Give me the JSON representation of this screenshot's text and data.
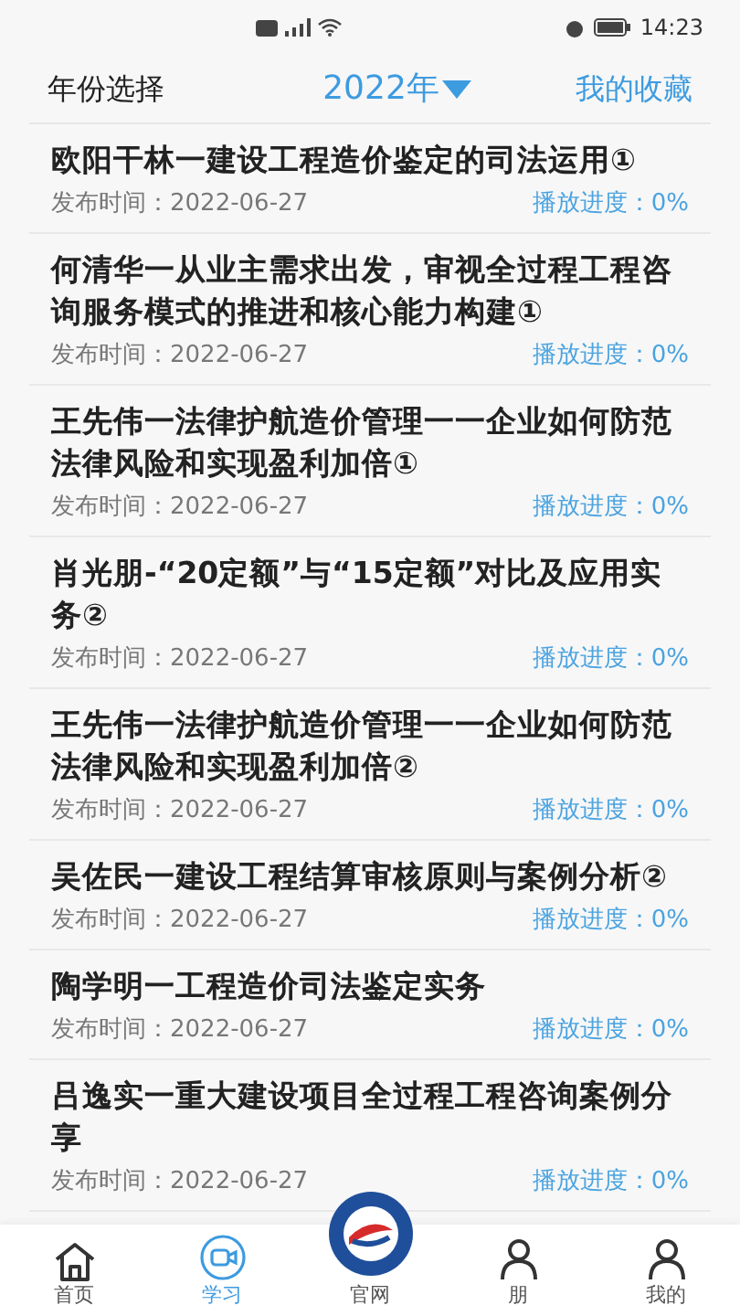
{
  "status_bar": {
    "time": "14:23"
  },
  "header": {
    "left": "年份选择",
    "year": "2022年",
    "right": "我的收藏"
  },
  "items": [
    {
      "title": "欧阳干林一建设工程造价鉴定的司法运用①",
      "published": "发布时间：2022-06-27",
      "progress": "播放进度：0%"
    },
    {
      "title": "何清华一从业主需求出发，审视全过程工程咨询服务模式的推进和核心能力构建①",
      "published": "发布时间：2022-06-27",
      "progress": "播放进度：0%"
    },
    {
      "title": "王先伟一法律护航造价管理一一企业如何防范法律风险和实现盈利加倍①",
      "published": "发布时间：2022-06-27",
      "progress": "播放进度：0%"
    },
    {
      "title": "肖光朋-“20定额”与“15定额”对比及应用实务②",
      "published": "发布时间：2022-06-27",
      "progress": "播放进度：0%"
    },
    {
      "title": "王先伟一法律护航造价管理一一企业如何防范法律风险和实现盈利加倍②",
      "published": "发布时间：2022-06-27",
      "progress": "播放进度：0%"
    },
    {
      "title": "吴佐民一建设工程结算审核原则与案例分析②",
      "published": "发布时间：2022-06-27",
      "progress": "播放进度：0%"
    },
    {
      "title": "陶学明一工程造价司法鉴定实务",
      "published": "发布时间：2022-06-27",
      "progress": "播放进度：0%"
    },
    {
      "title": "吕逸实一重大建设项目全过程工程咨询案例分享",
      "published": "发布时间：2022-06-27",
      "progress": "播放进度：0%"
    }
  ],
  "tabs": [
    {
      "kind": "home",
      "label": "首页",
      "selected": false
    },
    {
      "kind": "video",
      "label": "学习",
      "selected": true
    },
    {
      "kind": "logo",
      "label": "官网",
      "selected": false
    },
    {
      "kind": "person",
      "label": "朋",
      "selected": false
    },
    {
      "kind": "person",
      "label": "我的",
      "selected": false
    }
  ]
}
